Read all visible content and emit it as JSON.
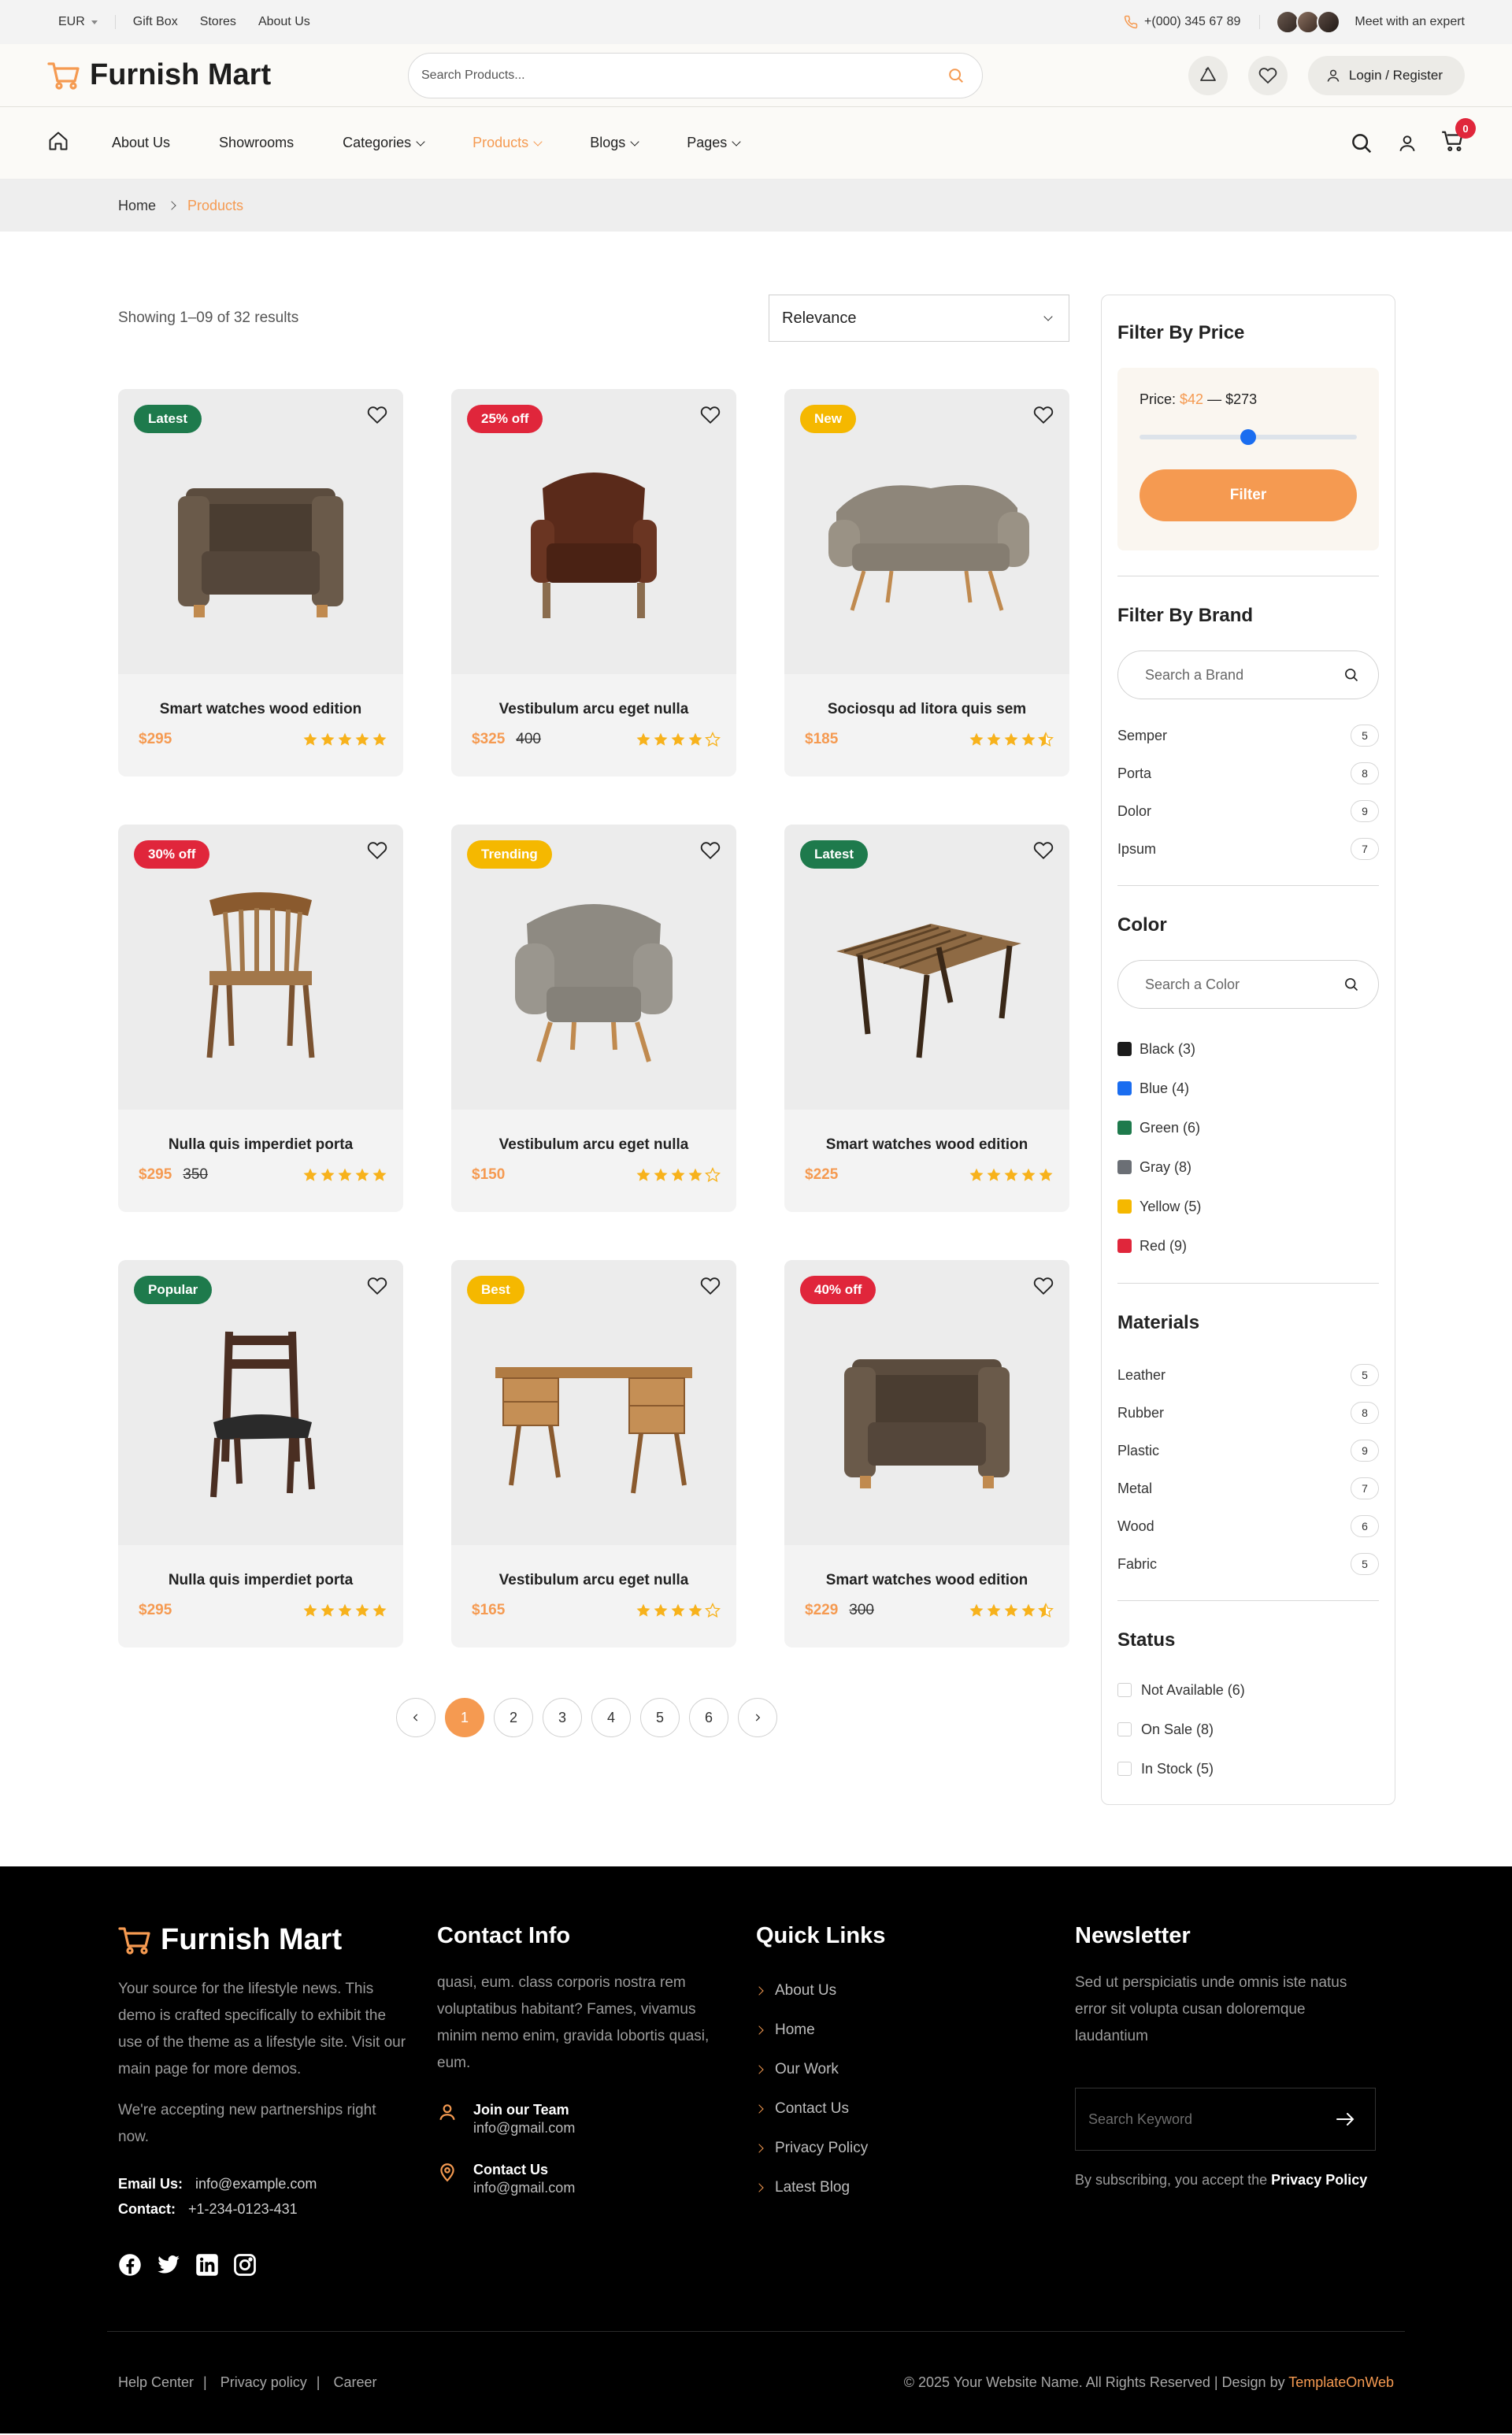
{
  "topbar": {
    "currency": "EUR",
    "links": [
      "Gift Box",
      "Stores",
      "About Us"
    ],
    "phone": "+(000) 345 67 89",
    "expert": "Meet with an expert"
  },
  "header": {
    "logo": "Furnish Mart",
    "search_placeholder": "Search Products...",
    "login": "Login / Register"
  },
  "nav": {
    "items": [
      {
        "label": "About Us",
        "dropdown": false
      },
      {
        "label": "Showrooms",
        "dropdown": false
      },
      {
        "label": "Categories",
        "dropdown": true
      },
      {
        "label": "Products",
        "dropdown": true,
        "active": true
      },
      {
        "label": "Blogs",
        "dropdown": true
      },
      {
        "label": "Pages",
        "dropdown": true
      }
    ],
    "cart_count": "0"
  },
  "breadcrumb": {
    "home": "Home",
    "current": "Products"
  },
  "toolbar": {
    "count": "Showing 1–09 of 32 results",
    "sort": "Relevance"
  },
  "products": [
    {
      "title": "Smart watches wood edition",
      "price": "$295",
      "old": "",
      "badge": "Latest",
      "badge_color": "#1e7a4c",
      "rating": 5,
      "img": "armchair-brown"
    },
    {
      "title": "Vestibulum arcu eget nulla",
      "price": "$325",
      "old": "400",
      "badge": "25% off",
      "badge_color": "#e0263b",
      "rating": 4,
      "img": "leather-chair"
    },
    {
      "title": "Sociosqu ad litora quis sem",
      "price": "$185",
      "old": "",
      "badge": "New",
      "badge_color": "#f5b800",
      "rating": 4.5,
      "img": "sofa-grey"
    },
    {
      "title": "Nulla quis imperdiet porta",
      "price": "$295",
      "old": "350",
      "badge": "30% off",
      "badge_color": "#e0263b",
      "rating": 5,
      "img": "wood-chair"
    },
    {
      "title": "Vestibulum arcu eget nulla",
      "price": "$150",
      "old": "",
      "badge": "Trending",
      "badge_color": "#f5b800",
      "rating": 4,
      "img": "grey-armchair"
    },
    {
      "title": "Smart watches wood edition",
      "price": "$225",
      "old": "",
      "badge": "Latest",
      "badge_color": "#1e7a4c",
      "rating": 5,
      "img": "wood-table"
    },
    {
      "title": "Nulla quis imperdiet porta",
      "price": "$295",
      "old": "",
      "badge": "Popular",
      "badge_color": "#1e7a4c",
      "rating": 5,
      "img": "dark-chair"
    },
    {
      "title": "Vestibulum arcu eget nulla",
      "price": "$165",
      "old": "",
      "badge": "Best",
      "badge_color": "#f5b800",
      "rating": 4,
      "img": "desk"
    },
    {
      "title": "Smart watches wood edition",
      "price": "$229",
      "old": "300",
      "badge": "40% off",
      "badge_color": "#e0263b",
      "rating": 4.5,
      "img": "armchair-brown"
    }
  ],
  "pagination": [
    "1",
    "2",
    "3",
    "4",
    "5",
    "6"
  ],
  "sidebar": {
    "price_title": "Filter By Price",
    "price_label": "Price:",
    "price_min": "$42",
    "price_max": "$273",
    "price_level": 0.5,
    "filter_btn": "Filter",
    "brand_title": "Filter By Brand",
    "brand_placeholder": "Search a Brand",
    "brands": [
      {
        "name": "Semper",
        "count": "5"
      },
      {
        "name": "Porta",
        "count": "8"
      },
      {
        "name": "Dolor",
        "count": "9"
      },
      {
        "name": "Ipsum",
        "count": "7"
      }
    ],
    "color_title": "Color",
    "color_placeholder": "Search a Color",
    "colors": [
      {
        "name": "Black (3)",
        "hex": "#1b1b1b"
      },
      {
        "name": "Blue (4)",
        "hex": "#1a6df0"
      },
      {
        "name": "Green (6)",
        "hex": "#1e7a4c"
      },
      {
        "name": "Gray (8)",
        "hex": "#6b6f75"
      },
      {
        "name": "Yellow (5)",
        "hex": "#f5b800"
      },
      {
        "name": "Red (9)",
        "hex": "#e0263b"
      }
    ],
    "materials_title": "Materials",
    "materials": [
      {
        "name": "Leather",
        "count": "5"
      },
      {
        "name": "Rubber",
        "count": "8"
      },
      {
        "name": "Plastic",
        "count": "9"
      },
      {
        "name": "Metal",
        "count": "7"
      },
      {
        "name": "Wood",
        "count": "6"
      },
      {
        "name": "Fabric",
        "count": "5"
      }
    ],
    "status_title": "Status",
    "status": [
      "Not Available (6)",
      "On Sale (8)",
      "In Stock (5)"
    ]
  },
  "footer": {
    "logo": "Furnish Mart",
    "about": "Your source for the lifestyle news. This demo is crafted specifically to exhibit the use of the theme as a lifestyle site. Visit our main page for more demos.",
    "partners": "We're accepting new partnerships right now.",
    "email_label": "Email Us:",
    "email": "info@example.com",
    "contact_label": "Contact:",
    "contact": "+1-234-0123-431",
    "contact_title": "Contact Info",
    "contact_text": "quasi, eum. class corporis nostra rem voluptatibus habitant? Fames, vivamus minim nemo enim, gravida lobortis quasi, eum.",
    "join_title": "Join our Team",
    "join_email": "info@gmail.com",
    "cu_title": "Contact Us",
    "cu_email": "info@gmail.com",
    "quick_title": "Quick Links",
    "quick_links": [
      "About Us",
      "Home",
      "Our Work",
      "Contact Us",
      "Privacy Policy",
      "Latest Blog"
    ],
    "news_title": "Newsletter",
    "news_text": "Sed ut perspiciatis unde omnis iste natus error sit volupta cusan doloremque laudantium",
    "news_placeholder": "Search Keyword",
    "news_note": "By subscribing, you accept the",
    "news_policy": "Privacy Policy",
    "bottom_links": [
      "Help Center",
      "Privacy policy",
      "Career"
    ],
    "copyright": "© 2025 Your Website Name. All Rights Reserved | Design by",
    "designer": "TemplateOnWeb"
  },
  "colors": {
    "accent": "#f59a51",
    "red": "#e0263b",
    "green": "#1e7a4c",
    "yellow": "#f5b800",
    "blue": "#1a6df0"
  }
}
